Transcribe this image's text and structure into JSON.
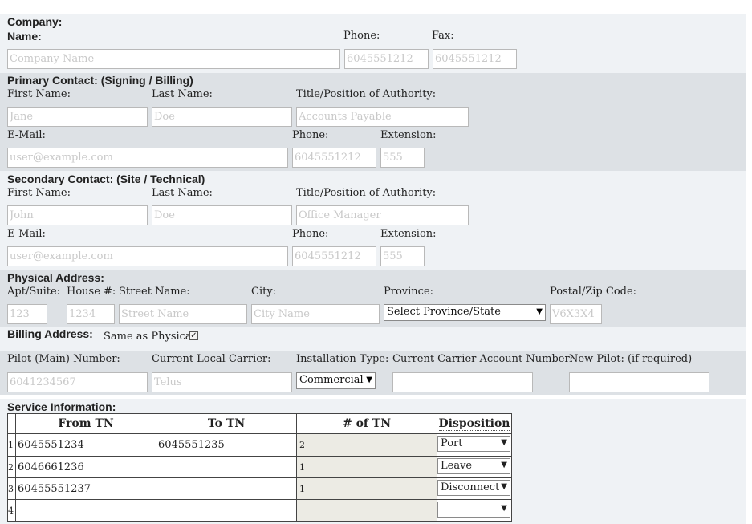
{
  "company": {
    "title": "Company:",
    "name_label": "Name:",
    "phone_label": "Phone:",
    "fax_label": "Fax:",
    "name_placeholder": "Company Name",
    "phone_placeholder": "6045551212",
    "fax_placeholder": "6045551212"
  },
  "primary": {
    "title": "Primary Contact: (Signing / Billing)",
    "first_label": "First Name:",
    "last_label": "Last Name:",
    "title_label": "Title/Position of Authority:",
    "first_placeholder": "Jane",
    "last_placeholder": "Doe",
    "title_placeholder": "Accounts Payable",
    "email_label": "E-Mail:",
    "phone_label": "Phone:",
    "ext_label": "Extension:",
    "email_placeholder": "user@example.com",
    "phone_placeholder": "6045551212",
    "ext_placeholder": "555"
  },
  "secondary": {
    "title": "Secondary Contact: (Site / Technical)",
    "first_label": "First Name:",
    "last_label": "Last Name:",
    "title_label": "Title/Position of Authority:",
    "first_placeholder": "John",
    "last_placeholder": "Doe",
    "title_placeholder": "Office Manager",
    "email_label": "E-Mail:",
    "phone_label": "Phone:",
    "ext_label": "Extension:",
    "email_placeholder": "user@example.com",
    "phone_placeholder": "6045551212",
    "ext_placeholder": "555"
  },
  "physical": {
    "title": "Physical Address:",
    "apt_label": "Apt/Suite:",
    "house_label": "House #:",
    "street_label": "Street Name:",
    "city_label": "City:",
    "province_label": "Province:",
    "postal_label": "Postal/Zip Code:",
    "apt_placeholder": "123",
    "house_placeholder": "1234",
    "street_placeholder": "Street Name",
    "city_placeholder": "City Name",
    "province_value": "Select Province/State",
    "postal_placeholder": "V6X3X4"
  },
  "billing": {
    "title": "Billing Address:",
    "same_label": "Same as Physical",
    "same_checked": true
  },
  "pilot": {
    "pilot_label": "Pilot (Main) Number:",
    "carrier_label": "Current Local Carrier:",
    "install_label": "Installation Type:",
    "account_label": "Current Carrier Account Number:",
    "newpilot_label": "New Pilot: (if required)",
    "pilot_placeholder": "6041234567",
    "carrier_placeholder": "Telus",
    "install_value": "Commercial"
  },
  "service": {
    "title": "Service Information:",
    "headers": [
      "From TN",
      "To TN",
      "# of TN",
      "Disposition"
    ],
    "rows": [
      {
        "num": "1",
        "from": "6045551234",
        "to": "6045551235",
        "count": "2",
        "disposition": "Port"
      },
      {
        "num": "2",
        "from": "6046661236",
        "to": "",
        "count": "1",
        "disposition": "Leave"
      },
      {
        "num": "3",
        "from": "60455551237",
        "to": "",
        "count": "1",
        "disposition": "Disconnect"
      },
      {
        "num": "4",
        "from": "",
        "to": "",
        "count": "",
        "disposition": ""
      }
    ]
  },
  "icons": {
    "dropdown": "▼",
    "check": "✓"
  }
}
